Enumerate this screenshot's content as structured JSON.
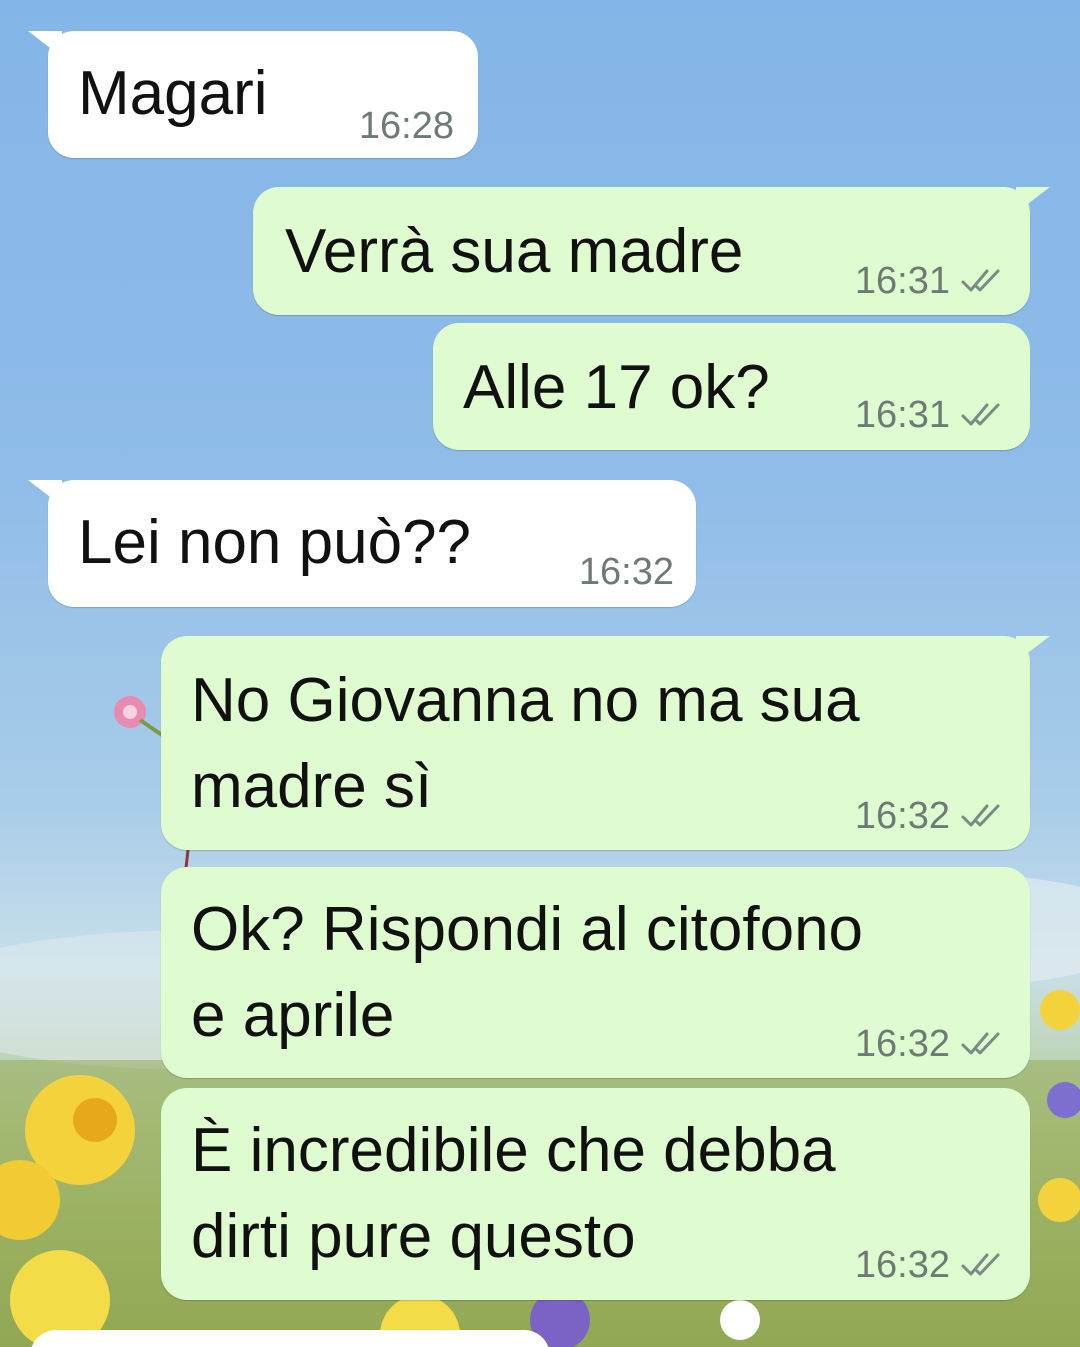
{
  "chat": {
    "messages": [
      {
        "direction": "incoming",
        "text": "Magari",
        "time": "16:28"
      },
      {
        "direction": "outgoing",
        "text": "Verrà sua madre",
        "time": "16:31",
        "status_icon": "double-check-icon"
      },
      {
        "direction": "outgoing",
        "text": "Alle 17 ok?",
        "time": "16:31",
        "status_icon": "double-check-icon"
      },
      {
        "direction": "incoming",
        "text": "Lei non può??",
        "time": "16:32"
      },
      {
        "direction": "outgoing",
        "text": "No Giovanna no ma sua\nmadre sì",
        "time": "16:32",
        "status_icon": "double-check-icon"
      },
      {
        "direction": "outgoing",
        "text": "Ok? Rispondi al citofono\ne aprile",
        "time": "16:32",
        "status_icon": "double-check-icon"
      },
      {
        "direction": "outgoing",
        "text": "È incredibile che debba\ndirti pure questo",
        "time": "16:32",
        "status_icon": "double-check-icon"
      }
    ]
  },
  "colors": {
    "incoming_bubble": "#ffffff",
    "outgoing_bubble": "#dffbd0",
    "text": "#111111",
    "meta": "#6e7b74",
    "wallpaper_sky": "#8db9e6"
  }
}
